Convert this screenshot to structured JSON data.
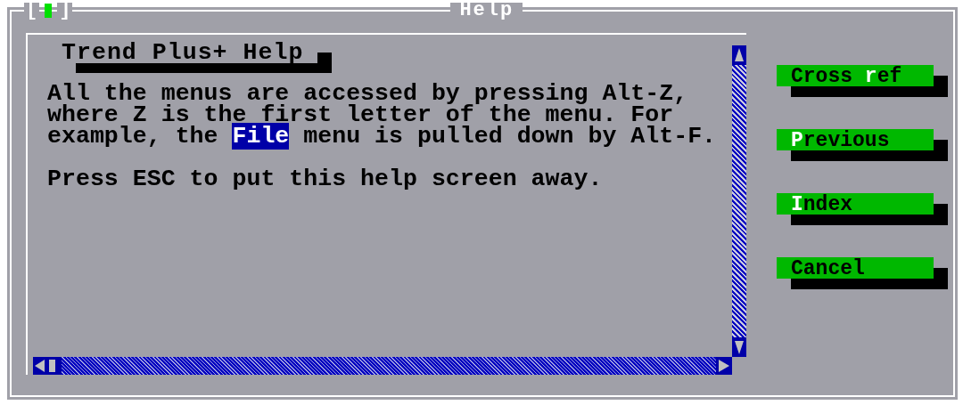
{
  "window": {
    "title": "Help",
    "close_box": {
      "left": "[",
      "right": "]"
    }
  },
  "help": {
    "heading": "Trend Plus+ Help",
    "paragraphs": [
      "All the menus are accessed by pressing Alt-Z, where Z is the first letter of the menu. For example, the **File** menu is pulled down by Alt-F.",
      "Press ESC to put this help screen away."
    ]
  },
  "buttons": [
    {
      "parts": [
        {
          "text": "Cross ",
          "hot": false
        },
        {
          "text": "r",
          "hot": true
        },
        {
          "text": "ef",
          "hot": false
        }
      ]
    },
    {
      "parts": [
        {
          "text": "P",
          "hot": true
        },
        {
          "text": "revious",
          "hot": false
        }
      ]
    },
    {
      "parts": [
        {
          "text": "I",
          "hot": true
        },
        {
          "text": "ndex",
          "hot": false
        }
      ]
    },
    {
      "parts": [
        {
          "text": "Cancel",
          "hot": false
        }
      ]
    }
  ]
}
